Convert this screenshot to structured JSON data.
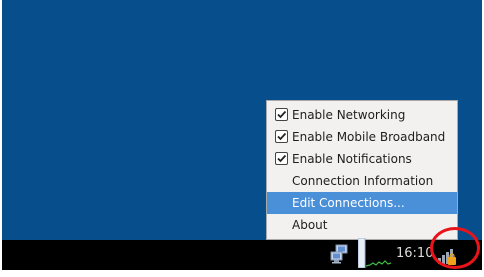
{
  "menu": {
    "items": [
      {
        "label": "Enable Networking",
        "checked": true
      },
      {
        "label": "Enable Mobile Broadband",
        "checked": true
      },
      {
        "label": "Enable Notifications",
        "checked": true
      },
      {
        "label": "Connection Information",
        "checked": false
      },
      {
        "label": "Edit Connections...",
        "checked": false,
        "highlighted": true
      },
      {
        "label": "About",
        "checked": false
      }
    ]
  },
  "taskbar": {
    "clock": "16:10"
  },
  "colors": {
    "desktop": "#074e8c",
    "taskbar": "#000000",
    "menu_background": "#f2f1f0",
    "menu_highlight": "#4a90d9",
    "annotation_ring": "#e8141b"
  },
  "icons": [
    "checkbox-icon",
    "network-computers-icon",
    "cpu-monitor-graph",
    "network-manager-tray-icon"
  ]
}
